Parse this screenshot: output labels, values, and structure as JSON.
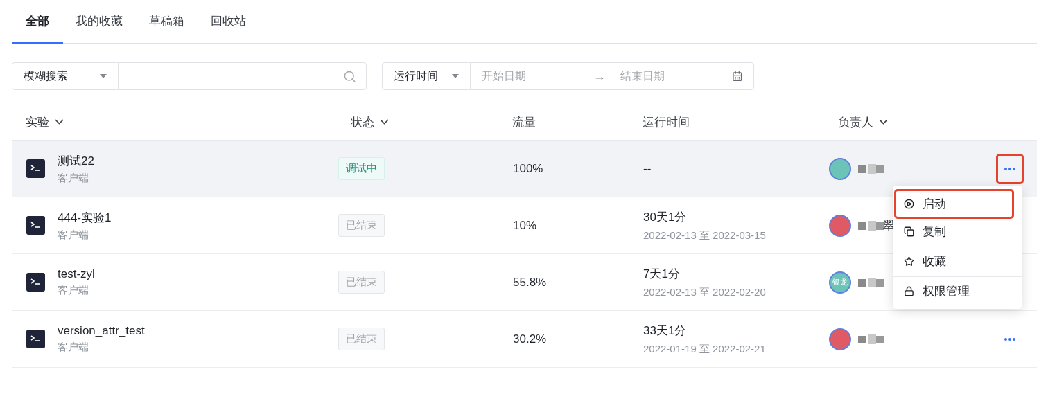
{
  "tabs": [
    {
      "label": "全部",
      "selected": true
    },
    {
      "label": "我的收藏",
      "selected": false
    },
    {
      "label": "草稿箱",
      "selected": false
    },
    {
      "label": "回收站",
      "selected": false
    }
  ],
  "filters": {
    "search_mode": "模糊搜索",
    "time_mode": "运行时间",
    "start_placeholder": "开始日期",
    "end_placeholder": "结束日期",
    "range_arrow": "→"
  },
  "table": {
    "columns": [
      {
        "label": "实验",
        "sortable": true
      },
      {
        "label": "状态",
        "sortable": true
      },
      {
        "label": "流量",
        "sortable": false
      },
      {
        "label": "运行时间",
        "sortable": false
      },
      {
        "label": "负责人",
        "sortable": true
      }
    ],
    "rows": [
      {
        "name": "测试22",
        "client": "客户端",
        "status": {
          "text": "调试中",
          "kind": "debugging"
        },
        "traffic": "100%",
        "runtime": "--",
        "hovered": true,
        "owner": {
          "color": "#6cc3b8"
        },
        "actions": {
          "annotated": true
        }
      },
      {
        "name": "444-实验1",
        "client": "客户端",
        "status": {
          "text": "已结束",
          "kind": "ended"
        },
        "traffic": "10%",
        "runtime": "30天1分",
        "dates": "2022-02-13 至 2022-03-15",
        "hovered": false,
        "owner": {
          "color": "#e05a66",
          "name_tail": "翠"
        }
      },
      {
        "name": "test-zyl",
        "client": "客户端",
        "status": {
          "text": "已结束",
          "kind": "ended"
        },
        "traffic": "55.8%",
        "runtime": "7天1分",
        "dates": "2022-02-13 至 2022-02-20",
        "hovered": false,
        "owner": {
          "color": "#6cc3b8",
          "avatar_text": "银龙"
        }
      },
      {
        "name": "version_attr_test",
        "client": "客户端",
        "status": {
          "text": "已结束",
          "kind": "ended"
        },
        "traffic": "30.2%",
        "runtime": "33天1分",
        "dates": "2022-01-19 至 2022-02-21",
        "hovered": false,
        "owner": {
          "color": "#e05a66"
        },
        "actions": {
          "annotated": false
        }
      }
    ]
  },
  "menu": [
    {
      "label": "启动",
      "annotated": true
    },
    {
      "label": "复制",
      "annotated": false
    },
    {
      "label": "收藏",
      "annotated": false
    },
    {
      "label": "权限管理",
      "annotated": false
    }
  ]
}
